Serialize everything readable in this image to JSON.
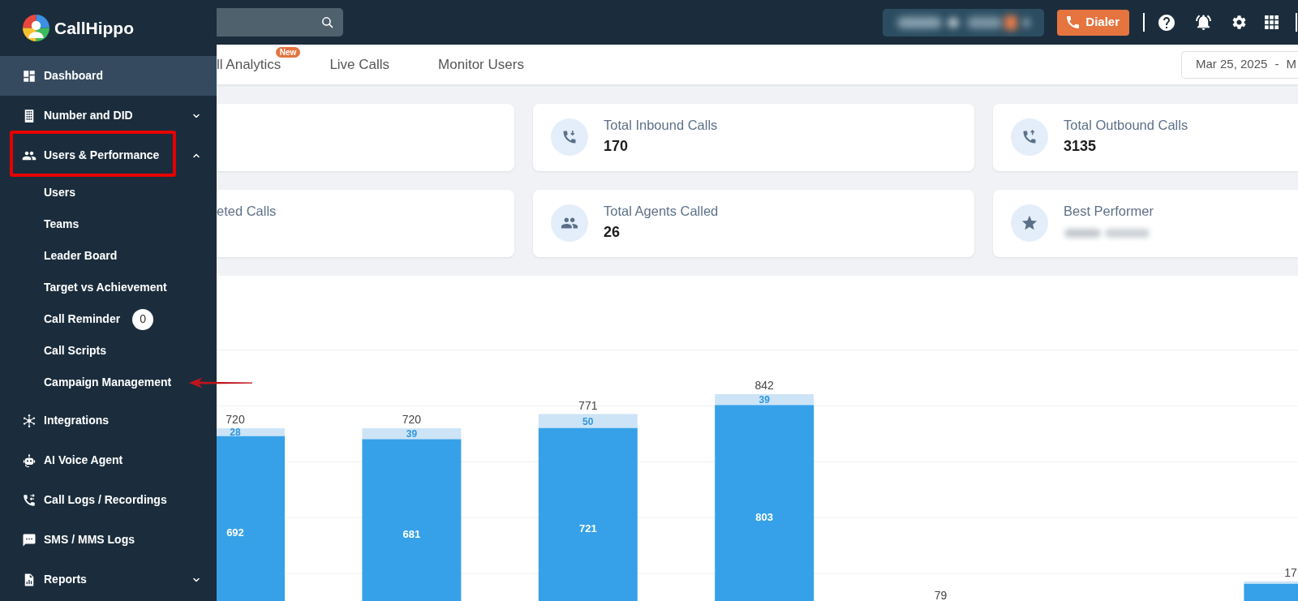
{
  "sidebar": {
    "logo": "CallHippo",
    "items": [
      {
        "label": "Dashboard",
        "kind": "link",
        "selected": true,
        "highlighted": false
      },
      {
        "label": "Number and DID",
        "kind": "group",
        "expanded": false,
        "selected": false,
        "highlighted": false
      },
      {
        "label": "Users & Performance",
        "kind": "group",
        "expanded": true,
        "selected": false,
        "highlighted": true,
        "children": [
          {
            "label": "Users",
            "selected": false,
            "highlighted": false
          },
          {
            "label": "Teams",
            "selected": false,
            "highlighted": false
          },
          {
            "label": "Leader Board",
            "selected": false,
            "highlighted": false
          },
          {
            "label": "Target vs Achievement",
            "selected": false,
            "highlighted": false
          },
          {
            "label": "Call Reminder",
            "badge": "0",
            "selected": false,
            "highlighted": false
          },
          {
            "label": "Call Scripts",
            "selected": false,
            "highlighted": false
          },
          {
            "label": "Campaign Management",
            "selected": false,
            "highlighted": true
          }
        ]
      },
      {
        "label": "Integrations",
        "kind": "link",
        "selected": false,
        "highlighted": false
      },
      {
        "label": "AI Voice Agent",
        "kind": "link",
        "selected": false,
        "highlighted": false
      },
      {
        "label": "Call Logs / Recordings",
        "kind": "link",
        "selected": false,
        "highlighted": false
      },
      {
        "label": "SMS / MMS Logs",
        "kind": "link",
        "selected": false,
        "highlighted": false
      },
      {
        "label": "Reports",
        "kind": "group",
        "expanded": false,
        "selected": false,
        "highlighted": false
      }
    ]
  },
  "header": {
    "blurred_info": true,
    "dialer_button": "Dialer"
  },
  "tabs": [
    {
      "label": "ll Analytics",
      "badge": "New"
    },
    {
      "label": "Live Calls"
    },
    {
      "label": "Monitor Users"
    }
  ],
  "date_range": {
    "start": "Mar 25, 2025",
    "separator": "-",
    "end": "M"
  },
  "stat_cards": [
    [
      {
        "kind": "blank"
      },
      {
        "kind": "stat",
        "label": "Total Inbound Calls",
        "value": "170"
      },
      {
        "kind": "stat",
        "label": "Total Outbound Calls",
        "value": "3135"
      }
    ],
    [
      {
        "kind": "label_only",
        "label": "eted Calls"
      },
      {
        "kind": "stat",
        "label": "Total Agents Called",
        "value": "26"
      },
      {
        "kind": "blurred_stat",
        "label": "Best Performer"
      }
    ]
  ],
  "chart": {
    "bars": [
      {
        "total": "720",
        "segments": [
          "28",
          "692"
        ]
      },
      {
        "total": "720",
        "segments": [
          "39",
          "681"
        ]
      },
      {
        "total": "771",
        "segments": [
          "50",
          "721"
        ]
      },
      {
        "total": "842",
        "segments": [
          "39",
          "803"
        ]
      },
      {
        "total": "79"
      },
      {
        "total": "17"
      }
    ]
  }
}
